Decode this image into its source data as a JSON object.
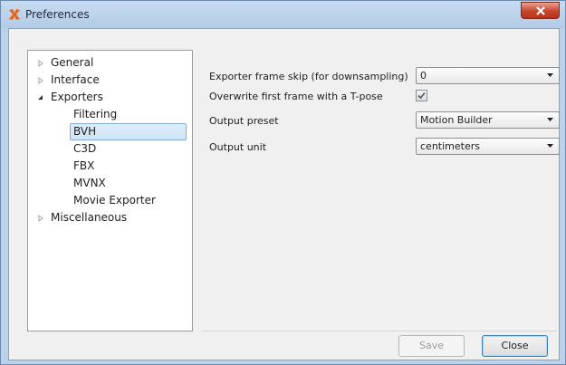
{
  "window": {
    "title": "Preferences"
  },
  "tree": {
    "items": [
      {
        "label": "General",
        "expander": "collapsed"
      },
      {
        "label": "Interface",
        "expander": "collapsed"
      },
      {
        "label": "Exporters",
        "expander": "expanded"
      },
      {
        "label": "Filtering"
      },
      {
        "label": "BVH",
        "selected": true
      },
      {
        "label": "C3D"
      },
      {
        "label": "FBX"
      },
      {
        "label": "MVNX"
      },
      {
        "label": "Movie Exporter"
      },
      {
        "label": "Miscellaneous",
        "expander": "collapsed"
      }
    ]
  },
  "settings": {
    "frame_skip": {
      "label": "Exporter frame skip (for downsampling)",
      "value": "0"
    },
    "overwrite_tpose": {
      "label": "Overwrite first frame with a T-pose",
      "checked": true
    },
    "output_preset": {
      "label": "Output preset",
      "value": "Motion Builder"
    },
    "output_unit": {
      "label": "Output unit",
      "value": "centimeters"
    }
  },
  "buttons": {
    "save": "Save",
    "close": "Close"
  },
  "colors": {
    "accent": "#3c7fb1",
    "title_close": "#c7442c"
  }
}
